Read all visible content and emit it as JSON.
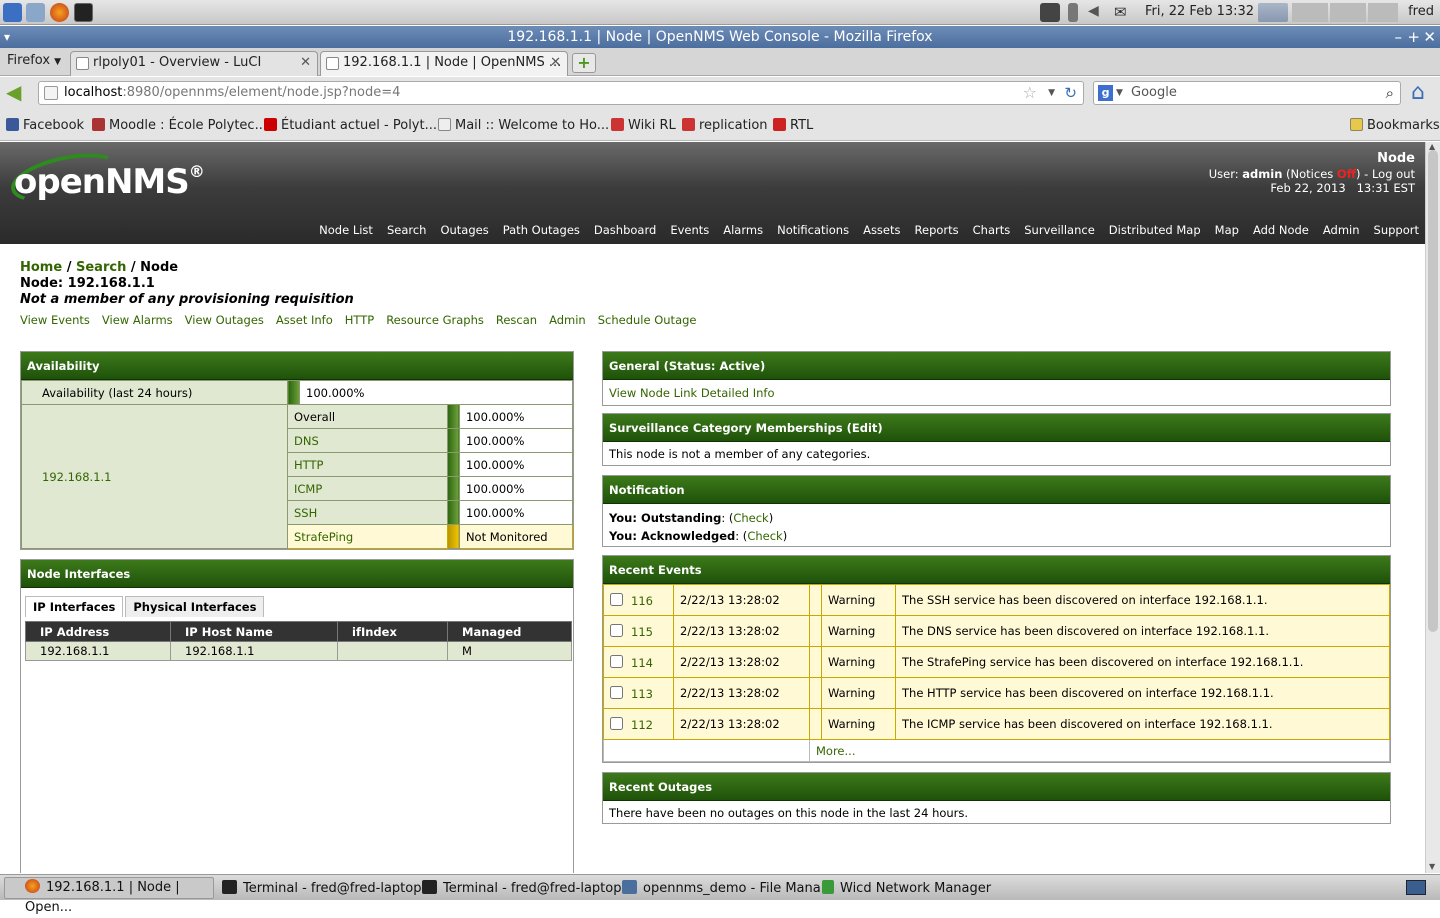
{
  "toppanel": {
    "datetime": "Fri, 22 Feb  13:32",
    "user": "fred"
  },
  "window": {
    "title": "192.168.1.1 | Node | OpenNMS Web Console - Mozilla Firefox"
  },
  "browser": {
    "menu_label": "Firefox",
    "tabs": [
      {
        "label": "rlpoly01 - Overview - LuCI"
      },
      {
        "label": "192.168.1.1 | Node | OpenNMS ..."
      }
    ],
    "url_host": "localhost",
    "url_rest": ":8980/opennms/element/node.jsp?node=4",
    "search_placeholder": "Google",
    "bookmarks": [
      "Facebook",
      "Moodle : École Polytec...",
      "Étudiant actuel - Polyt...",
      "Mail :: Welcome to Ho...",
      "Wiki RL",
      "replication",
      "RTL"
    ],
    "bookmarks_menu": "Bookmarks"
  },
  "header": {
    "logo": "openNMS",
    "logo_mark": "®",
    "page_title": "Node",
    "user_prefix": "User: ",
    "user_name": "admin",
    "notices_prefix": " (Notices ",
    "notices_state": "Off",
    "notices_suffix": ") - ",
    "logout": "Log out",
    "date": "Feb 22, 2013",
    "time": "13:31 EST",
    "nav": [
      "Node List",
      "Search",
      "Outages",
      "Path Outages",
      "Dashboard",
      "Events",
      "Alarms",
      "Notifications",
      "Assets",
      "Reports",
      "Charts",
      "Surveillance",
      "Distributed Map",
      "Map",
      "Add Node",
      "Admin",
      "Support"
    ]
  },
  "breadcrumb": {
    "home": "Home",
    "search": "Search",
    "current": "Node",
    "sep": " / "
  },
  "node": {
    "label_line": "Node: 192.168.1.1",
    "requisition": "Not a member of any provisioning requisition",
    "links": [
      "View Events",
      "View Alarms",
      "View Outages",
      "Asset Info",
      "HTTP",
      "Resource Graphs",
      "Rescan",
      "Admin",
      "Schedule Outage"
    ]
  },
  "availability": {
    "title": "Availability",
    "label_24h": "Availability (last 24 hours)",
    "value_24h": "100.000%",
    "interface": "192.168.1.1",
    "services": [
      {
        "name": "Overall",
        "value": "100.000%"
      },
      {
        "name": "DNS",
        "value": "100.000%"
      },
      {
        "name": "HTTP",
        "value": "100.000%"
      },
      {
        "name": "ICMP",
        "value": "100.000%"
      },
      {
        "name": "SSH",
        "value": "100.000%"
      },
      {
        "name": "StrafePing",
        "value": "Not Monitored"
      }
    ]
  },
  "interfaces": {
    "title": "Node Interfaces",
    "tabs": [
      "IP Interfaces",
      "Physical Interfaces"
    ],
    "columns": [
      "IP Address",
      "IP Host Name",
      "ifIndex",
      "Managed"
    ],
    "rows": [
      [
        "192.168.1.1",
        "192.168.1.1",
        "",
        "M"
      ]
    ]
  },
  "general": {
    "title": "General (Status: Active)",
    "link": "View Node Link Detailed Info"
  },
  "surveillance": {
    "title": "Surveillance Category Memberships (Edit)",
    "text": "This node is not a member of any categories."
  },
  "notification": {
    "title": "Notification",
    "outstanding_label": "You: Outstanding",
    "acknowledged_label": "You: Acknowledged",
    "check": "Check"
  },
  "events": {
    "title": "Recent Events",
    "rows": [
      {
        "id": "116",
        "time": "2/22/13 13:28:02",
        "severity": "Warning",
        "msg": "The SSH service has been discovered on interface 192.168.1.1."
      },
      {
        "id": "115",
        "time": "2/22/13 13:28:02",
        "severity": "Warning",
        "msg": "The DNS service has been discovered on interface 192.168.1.1."
      },
      {
        "id": "114",
        "time": "2/22/13 13:28:02",
        "severity": "Warning",
        "msg": "The StrafePing service has been discovered on interface 192.168.1.1."
      },
      {
        "id": "113",
        "time": "2/22/13 13:28:02",
        "severity": "Warning",
        "msg": "The HTTP service has been discovered on interface 192.168.1.1."
      },
      {
        "id": "112",
        "time": "2/22/13 13:28:02",
        "severity": "Warning",
        "msg": "The ICMP service has been discovered on interface 192.168.1.1."
      }
    ],
    "more": "More..."
  },
  "outages": {
    "title": "Recent Outages",
    "text": "There have been no outages on this node in the last 24 hours."
  },
  "taskbar": [
    "192.168.1.1 | Node | Open...",
    "Terminal - fred@fred-laptop...",
    "Terminal - fred@fred-laptop...",
    "opennms_demo - File Mana...",
    "Wicd Network Manager"
  ],
  "colors": {
    "brand_green": "#336600",
    "panel_header": "#2e6a12",
    "warning": "#f0c400"
  }
}
